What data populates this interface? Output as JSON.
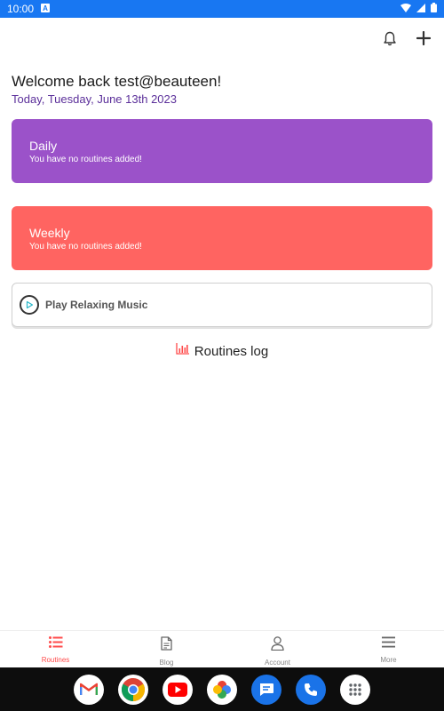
{
  "status_bar": {
    "time": "10:00"
  },
  "header": {
    "welcome": "Welcome back test@beauteen!",
    "date": "Today, Tuesday, June 13th 2023"
  },
  "cards": [
    {
      "title": "Daily",
      "subtitle": "You have no routines added!",
      "color": "#9b52c9"
    },
    {
      "title": "Weekly",
      "subtitle": "You have no routines added!",
      "color": "#ff6461"
    }
  ],
  "music": {
    "label": "Play Relaxing Music"
  },
  "routines_log": {
    "label": "Routines log"
  },
  "bottom_nav": [
    {
      "label": "Routines",
      "icon": "list-icon",
      "active": true
    },
    {
      "label": "Blog",
      "icon": "document-icon",
      "active": false
    },
    {
      "label": "Account",
      "icon": "person-icon",
      "active": false
    },
    {
      "label": "More",
      "icon": "menu-icon",
      "active": false
    }
  ],
  "dock": [
    "gmail-icon",
    "chrome-icon",
    "youtube-icon",
    "photos-icon",
    "messages-icon",
    "phone-icon",
    "apps-icon"
  ],
  "colors": {
    "accent": "#ff4b4b",
    "status_bar": "#1877f2",
    "date_text": "#5b2f9a"
  }
}
